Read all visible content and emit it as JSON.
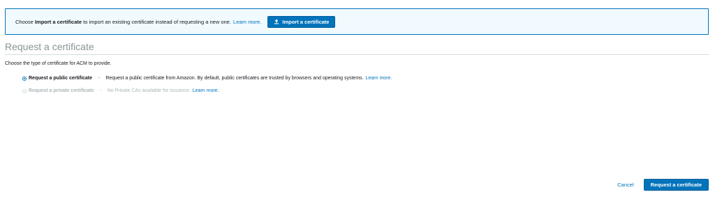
{
  "banner": {
    "prefix": "Choose ",
    "bold": "Import a certificate",
    "suffix": " to import an existing certificate instead of requesting a new one.",
    "learn_more": "Learn more.",
    "import_button": "Import a certificate",
    "import_icon": "upload-icon"
  },
  "section": {
    "title": "Request a certificate",
    "instruction": "Choose the type of certificate for ACM to provide."
  },
  "options": [
    {
      "label": "Request a public certificate",
      "separator": "-",
      "description": "Request a public certificate from Amazon. By default, public certificates are trusted by browsers and operating systems.",
      "learn_more": "Learn more.",
      "selected": true,
      "disabled": false
    },
    {
      "label": "Request a private certificate",
      "separator": "-",
      "description": "No Private CAs available for issuance.",
      "learn_more": "Learn more.",
      "selected": false,
      "disabled": true
    }
  ],
  "footer": {
    "cancel": "Cancel",
    "submit": "Request a certificate"
  },
  "colors": {
    "accent": "#0073bb",
    "banner_bg": "#f1faff",
    "title": "#879596",
    "disabled": "#aab7b8"
  }
}
